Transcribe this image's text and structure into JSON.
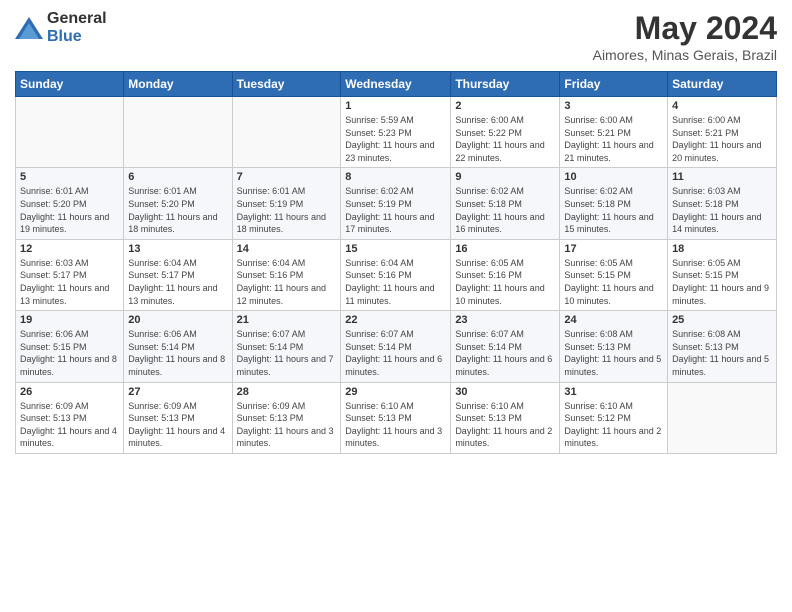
{
  "logo": {
    "general": "General",
    "blue": "Blue"
  },
  "title": {
    "month_year": "May 2024",
    "location": "Aimores, Minas Gerais, Brazil"
  },
  "weekdays": [
    "Sunday",
    "Monday",
    "Tuesday",
    "Wednesday",
    "Thursday",
    "Friday",
    "Saturday"
  ],
  "weeks": [
    [
      {
        "day": "",
        "sunrise": "",
        "sunset": "",
        "daylight": ""
      },
      {
        "day": "",
        "sunrise": "",
        "sunset": "",
        "daylight": ""
      },
      {
        "day": "",
        "sunrise": "",
        "sunset": "",
        "daylight": ""
      },
      {
        "day": "1",
        "sunrise": "Sunrise: 5:59 AM",
        "sunset": "Sunset: 5:23 PM",
        "daylight": "Daylight: 11 hours and 23 minutes."
      },
      {
        "day": "2",
        "sunrise": "Sunrise: 6:00 AM",
        "sunset": "Sunset: 5:22 PM",
        "daylight": "Daylight: 11 hours and 22 minutes."
      },
      {
        "day": "3",
        "sunrise": "Sunrise: 6:00 AM",
        "sunset": "Sunset: 5:21 PM",
        "daylight": "Daylight: 11 hours and 21 minutes."
      },
      {
        "day": "4",
        "sunrise": "Sunrise: 6:00 AM",
        "sunset": "Sunset: 5:21 PM",
        "daylight": "Daylight: 11 hours and 20 minutes."
      }
    ],
    [
      {
        "day": "5",
        "sunrise": "Sunrise: 6:01 AM",
        "sunset": "Sunset: 5:20 PM",
        "daylight": "Daylight: 11 hours and 19 minutes."
      },
      {
        "day": "6",
        "sunrise": "Sunrise: 6:01 AM",
        "sunset": "Sunset: 5:20 PM",
        "daylight": "Daylight: 11 hours and 18 minutes."
      },
      {
        "day": "7",
        "sunrise": "Sunrise: 6:01 AM",
        "sunset": "Sunset: 5:19 PM",
        "daylight": "Daylight: 11 hours and 18 minutes."
      },
      {
        "day": "8",
        "sunrise": "Sunrise: 6:02 AM",
        "sunset": "Sunset: 5:19 PM",
        "daylight": "Daylight: 11 hours and 17 minutes."
      },
      {
        "day": "9",
        "sunrise": "Sunrise: 6:02 AM",
        "sunset": "Sunset: 5:18 PM",
        "daylight": "Daylight: 11 hours and 16 minutes."
      },
      {
        "day": "10",
        "sunrise": "Sunrise: 6:02 AM",
        "sunset": "Sunset: 5:18 PM",
        "daylight": "Daylight: 11 hours and 15 minutes."
      },
      {
        "day": "11",
        "sunrise": "Sunrise: 6:03 AM",
        "sunset": "Sunset: 5:18 PM",
        "daylight": "Daylight: 11 hours and 14 minutes."
      }
    ],
    [
      {
        "day": "12",
        "sunrise": "Sunrise: 6:03 AM",
        "sunset": "Sunset: 5:17 PM",
        "daylight": "Daylight: 11 hours and 13 minutes."
      },
      {
        "day": "13",
        "sunrise": "Sunrise: 6:04 AM",
        "sunset": "Sunset: 5:17 PM",
        "daylight": "Daylight: 11 hours and 13 minutes."
      },
      {
        "day": "14",
        "sunrise": "Sunrise: 6:04 AM",
        "sunset": "Sunset: 5:16 PM",
        "daylight": "Daylight: 11 hours and 12 minutes."
      },
      {
        "day": "15",
        "sunrise": "Sunrise: 6:04 AM",
        "sunset": "Sunset: 5:16 PM",
        "daylight": "Daylight: 11 hours and 11 minutes."
      },
      {
        "day": "16",
        "sunrise": "Sunrise: 6:05 AM",
        "sunset": "Sunset: 5:16 PM",
        "daylight": "Daylight: 11 hours and 10 minutes."
      },
      {
        "day": "17",
        "sunrise": "Sunrise: 6:05 AM",
        "sunset": "Sunset: 5:15 PM",
        "daylight": "Daylight: 11 hours and 10 minutes."
      },
      {
        "day": "18",
        "sunrise": "Sunrise: 6:05 AM",
        "sunset": "Sunset: 5:15 PM",
        "daylight": "Daylight: 11 hours and 9 minutes."
      }
    ],
    [
      {
        "day": "19",
        "sunrise": "Sunrise: 6:06 AM",
        "sunset": "Sunset: 5:15 PM",
        "daylight": "Daylight: 11 hours and 8 minutes."
      },
      {
        "day": "20",
        "sunrise": "Sunrise: 6:06 AM",
        "sunset": "Sunset: 5:14 PM",
        "daylight": "Daylight: 11 hours and 8 minutes."
      },
      {
        "day": "21",
        "sunrise": "Sunrise: 6:07 AM",
        "sunset": "Sunset: 5:14 PM",
        "daylight": "Daylight: 11 hours and 7 minutes."
      },
      {
        "day": "22",
        "sunrise": "Sunrise: 6:07 AM",
        "sunset": "Sunset: 5:14 PM",
        "daylight": "Daylight: 11 hours and 6 minutes."
      },
      {
        "day": "23",
        "sunrise": "Sunrise: 6:07 AM",
        "sunset": "Sunset: 5:14 PM",
        "daylight": "Daylight: 11 hours and 6 minutes."
      },
      {
        "day": "24",
        "sunrise": "Sunrise: 6:08 AM",
        "sunset": "Sunset: 5:13 PM",
        "daylight": "Daylight: 11 hours and 5 minutes."
      },
      {
        "day": "25",
        "sunrise": "Sunrise: 6:08 AM",
        "sunset": "Sunset: 5:13 PM",
        "daylight": "Daylight: 11 hours and 5 minutes."
      }
    ],
    [
      {
        "day": "26",
        "sunrise": "Sunrise: 6:09 AM",
        "sunset": "Sunset: 5:13 PM",
        "daylight": "Daylight: 11 hours and 4 minutes."
      },
      {
        "day": "27",
        "sunrise": "Sunrise: 6:09 AM",
        "sunset": "Sunset: 5:13 PM",
        "daylight": "Daylight: 11 hours and 4 minutes."
      },
      {
        "day": "28",
        "sunrise": "Sunrise: 6:09 AM",
        "sunset": "Sunset: 5:13 PM",
        "daylight": "Daylight: 11 hours and 3 minutes."
      },
      {
        "day": "29",
        "sunrise": "Sunrise: 6:10 AM",
        "sunset": "Sunset: 5:13 PM",
        "daylight": "Daylight: 11 hours and 3 minutes."
      },
      {
        "day": "30",
        "sunrise": "Sunrise: 6:10 AM",
        "sunset": "Sunset: 5:13 PM",
        "daylight": "Daylight: 11 hours and 2 minutes."
      },
      {
        "day": "31",
        "sunrise": "Sunrise: 6:10 AM",
        "sunset": "Sunset: 5:12 PM",
        "daylight": "Daylight: 11 hours and 2 minutes."
      },
      {
        "day": "",
        "sunrise": "",
        "sunset": "",
        "daylight": ""
      }
    ]
  ]
}
